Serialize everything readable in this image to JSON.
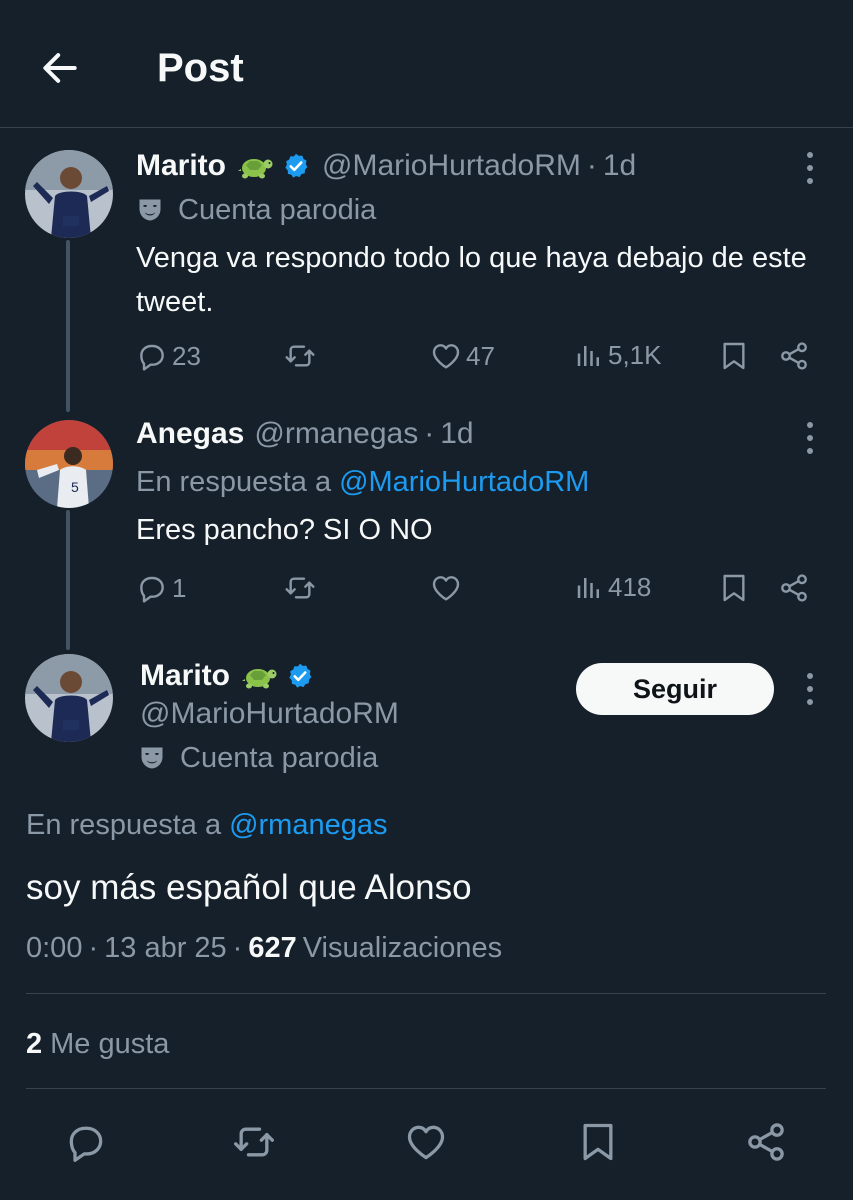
{
  "header": {
    "title": "Post"
  },
  "thread": [
    {
      "name": "Marito",
      "handle": "@MarioHurtadoRM",
      "time": "1d",
      "label": "Cuenta parodia",
      "text": "Venga va respondo todo lo que haya debajo de este tweet.",
      "replies": "23",
      "retweets": "",
      "likes": "47",
      "views": "5,1K"
    },
    {
      "name": "Anegas",
      "handle": "@rmanegas",
      "time": "1d",
      "reply_prefix": "En respuesta a",
      "reply_to": "@MarioHurtadoRM",
      "text": "Eres pancho? SI O NO",
      "replies": "1",
      "retweets": "",
      "likes": "",
      "views": "418"
    }
  ],
  "main": {
    "name": "Marito",
    "handle": "@MarioHurtadoRM",
    "label": "Cuenta parodia",
    "follow_label": "Seguir",
    "reply_prefix": "En respuesta a",
    "reply_to": "@rmanegas",
    "text": "soy más español que Alonso",
    "time": "0:00",
    "date": "13 abr 25",
    "views_count": "627",
    "views_label": "Visualizaciones",
    "likes_count": "2",
    "likes_label": "Me gusta"
  },
  "colors": {
    "background": "#15202b",
    "accent": "#1d9bf0",
    "muted": "#8b98a5",
    "divider": "#38444d"
  },
  "icons": [
    "back-arrow-icon",
    "turtle-emoji-icon",
    "verified-badge-icon",
    "parody-mask-icon",
    "reply-icon",
    "retweet-icon",
    "like-icon",
    "views-icon",
    "bookmark-icon",
    "share-icon",
    "more-options-icon"
  ]
}
